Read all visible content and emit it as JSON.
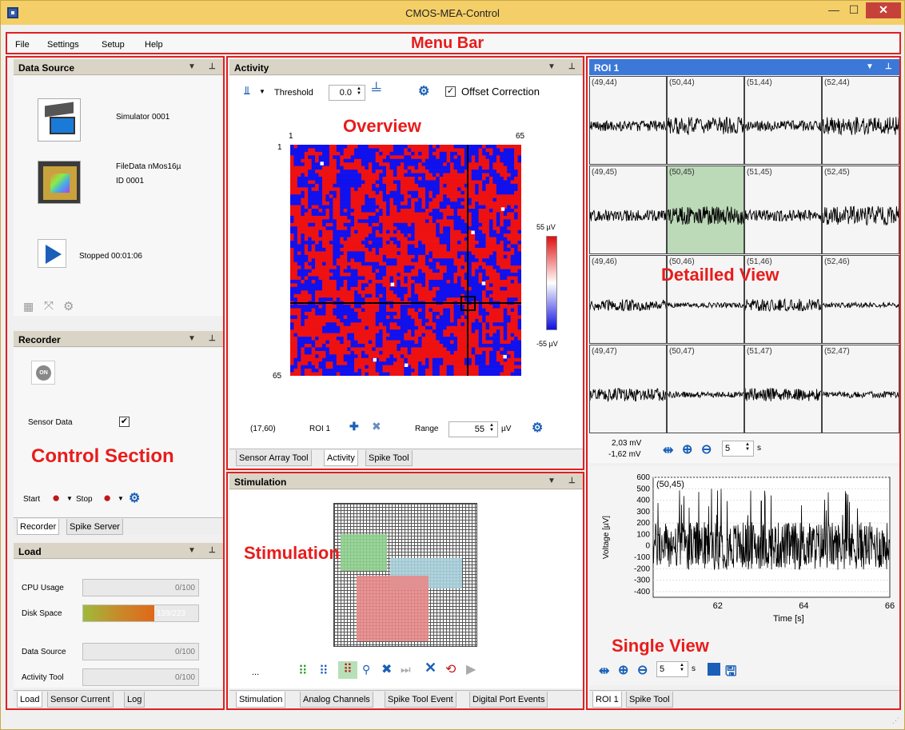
{
  "window": {
    "title": "CMOS-MEA-Control",
    "minimize": "—",
    "maximize": "☐",
    "close": "✕"
  },
  "menu": {
    "items": [
      "File",
      "Settings",
      "Setup",
      "Help"
    ]
  },
  "annotations": {
    "menu_bar": "Menu Bar",
    "overview": "Overview",
    "detailed_view": "Detailled View",
    "control_section": "Control Section",
    "stimulation": "Stimulation",
    "single_view": "Single View"
  },
  "data_source": {
    "header": "Data Source",
    "simulator_label": "Simulator 0001",
    "file_label_1": "FileData nMos16µ",
    "file_label_2": "ID 0001",
    "status": "Stopped 00:01:06"
  },
  "recorder": {
    "header": "Recorder",
    "on_label": "ON",
    "sensor_data_label": "Sensor Data",
    "sensor_data_checked": true,
    "start_label": "Start",
    "stop_label": "Stop",
    "tabs": [
      "Recorder",
      "Spike Server"
    ]
  },
  "load": {
    "header": "Load",
    "rows": [
      {
        "label": "CPU Usage",
        "value": "0/100",
        "fraction": 0
      },
      {
        "label": "Disk Space",
        "value": "139/223",
        "fraction": 0.62
      },
      {
        "label": "Data Source",
        "value": "0/100",
        "fraction": 0
      },
      {
        "label": "Activity Tool",
        "value": "0/100",
        "fraction": 0
      }
    ],
    "tabs": [
      "Load",
      "Sensor Current",
      "Log"
    ]
  },
  "activity": {
    "header": "Activity",
    "threshold_label": "Threshold",
    "threshold_value": "0.0",
    "offset_label": "Offset Correction",
    "offset_checked": true,
    "axis_top_left": "1",
    "axis_top_right": "65",
    "axis_left_top": "1",
    "axis_left_bottom": "65",
    "scale_max": "55 µV",
    "scale_min": "-55 µV",
    "coords": "(17,60)",
    "roi_label": "ROI 1",
    "range_label": "Range",
    "range_value": "55",
    "range_unit": "µV",
    "tabs": [
      "Sensor Array Tool",
      "Activity",
      "Spike Tool"
    ]
  },
  "stimulation": {
    "header": "Stimulation",
    "ellipsis": "...",
    "tabs": [
      "Stimulation",
      "Analog Channels",
      "Spike Tool Event",
      "Digital Port Events"
    ]
  },
  "roi": {
    "header": "ROI 1",
    "cells": [
      "(49,44)",
      "(50,44)",
      "(51,44)",
      "(52,44)",
      "(49,45)",
      "(50,45)",
      "(51,45)",
      "(52,45)",
      "(49,46)",
      "(50,46)",
      "(51,46)",
      "(52,46)",
      "(49,47)",
      "(50,47)",
      "(51,47)",
      "(52,47)"
    ],
    "selected_index": 5,
    "readout_1": "2,03 mV",
    "readout_2": "-1,62 mV",
    "zoom_value": "5",
    "zoom_unit": "s"
  },
  "single_view": {
    "plot_label": "(50,45)",
    "ylabel": "Voltage [µV]",
    "xlabel": "Time [s]",
    "yticks": [
      "600",
      "500",
      "400",
      "300",
      "200",
      "100",
      "0",
      "-100",
      "-200",
      "-300",
      "-400"
    ],
    "xticks": [
      "62",
      "64",
      "66"
    ],
    "zoom_value": "5",
    "zoom_unit": "s",
    "tabs": [
      "ROI 1",
      "Spike Tool"
    ]
  },
  "colors": {
    "accent_red": "#e81c1c",
    "heat_red": "#ee1111",
    "heat_blue": "#1111ee",
    "roi_header": "#3c78d8",
    "stim_green": "#8fd08f",
    "stim_blue": "#a8d0dc",
    "stim_red": "#e88a8a"
  }
}
